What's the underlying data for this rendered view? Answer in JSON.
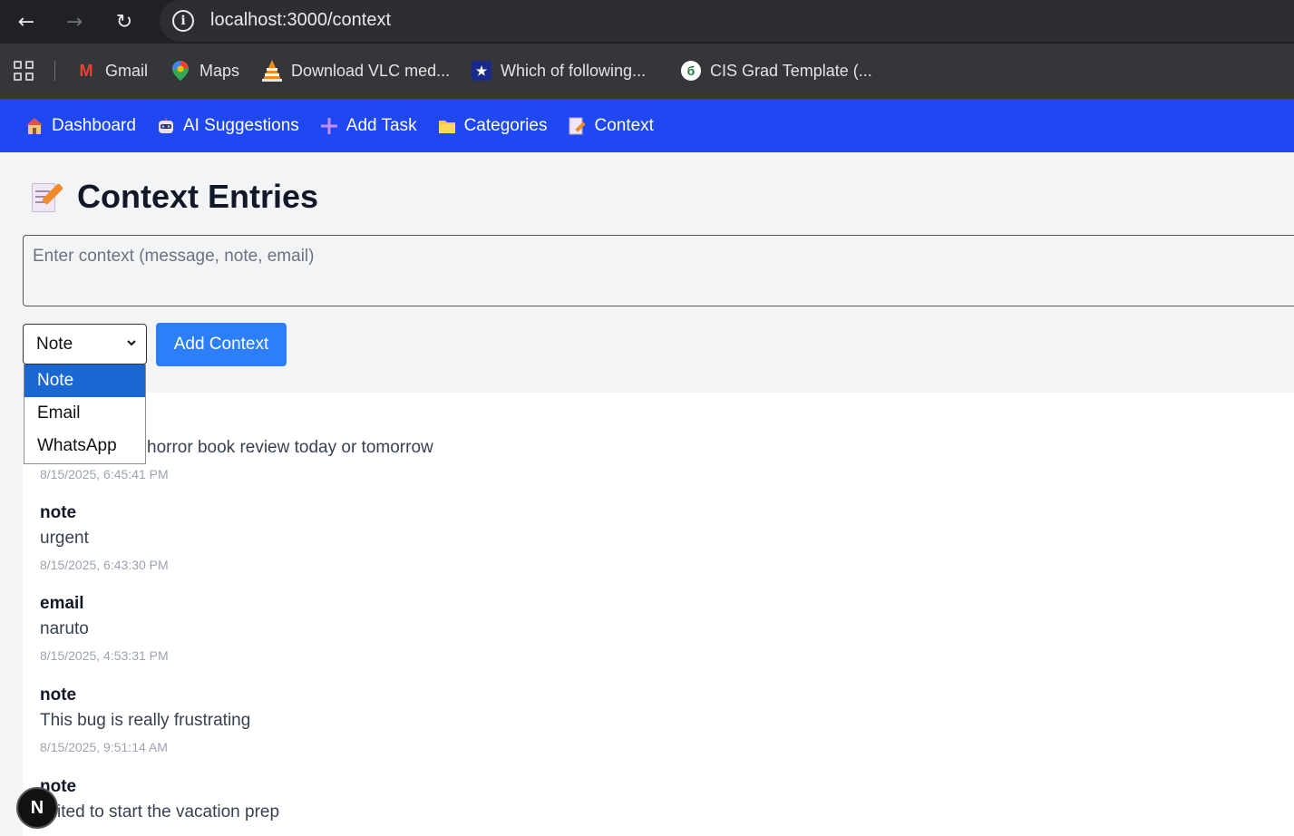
{
  "browser": {
    "url": "localhost:3000/context",
    "bookmarks": [
      {
        "label": "Gmail",
        "icon": "gmail-icon"
      },
      {
        "label": "Maps",
        "icon": "maps-icon"
      },
      {
        "label": "Download VLC med...",
        "icon": "vlc-icon"
      },
      {
        "label": "Which of following...",
        "icon": "star-badge-icon"
      },
      {
        "label": "CIS Grad Template (...",
        "icon": "overleaf-icon"
      }
    ]
  },
  "nav": {
    "items": [
      {
        "label": "Dashboard",
        "icon": "house-icon"
      },
      {
        "label": "AI Suggestions",
        "icon": "robot-icon"
      },
      {
        "label": "Add Task",
        "icon": "plus-icon"
      },
      {
        "label": "Categories",
        "icon": "folder-icon"
      },
      {
        "label": "Context",
        "icon": "memo-icon"
      }
    ],
    "accent": "#1f48f3"
  },
  "page": {
    "title": "Context Entries",
    "textarea_placeholder": "Enter context (message, note, email)",
    "select_value": "Note",
    "select_options": [
      "Note",
      "Email",
      "WhatsApp"
    ],
    "add_button": "Add Context"
  },
  "entries": [
    {
      "type": "",
      "text": "horror book review today or tomorrow",
      "time": "8/15/2025, 6:45:41 PM"
    },
    {
      "type": "note",
      "text": "urgent",
      "time": "8/15/2025, 6:43:30 PM"
    },
    {
      "type": "email",
      "text": "naruto",
      "time": "8/15/2025, 4:53:31 PM"
    },
    {
      "type": "note",
      "text": "This bug is really frustrating",
      "time": "8/15/2025, 9:51:14 AM"
    },
    {
      "type": "note",
      "text": "xcited to start the vacation prep",
      "time": ""
    }
  ],
  "badge": "N"
}
